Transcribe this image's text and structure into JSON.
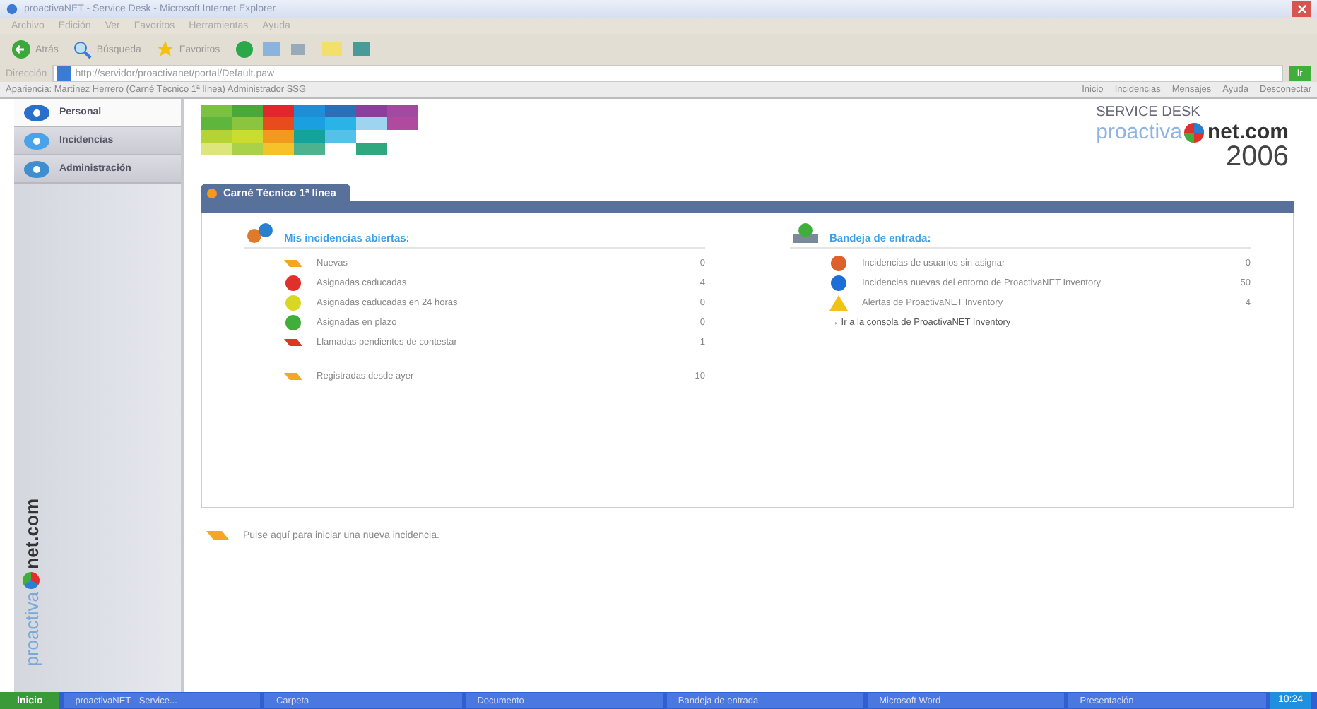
{
  "window": {
    "title": "proactivaNET - Service Desk - Microsoft Internet Explorer"
  },
  "menu": [
    "Archivo",
    "Edición",
    "Ver",
    "Favoritos",
    "Herramientas",
    "Ayuda"
  ],
  "toolbar": [
    {
      "label": "Atrás",
      "kind": "back"
    },
    {
      "label": "Búsqueda",
      "kind": "search"
    },
    {
      "label": "Favoritos",
      "kind": "star"
    }
  ],
  "address": {
    "label": "Dirección",
    "value": "http://servidor/proactivanet/portal/Default.paw",
    "go": "Ir"
  },
  "links_bar": {
    "context": "Apariencia: Martínez Herrero (Carné Técnico 1ª línea) Administrador SSG",
    "links": [
      "Inicio",
      "Incidencias",
      "Mensajes",
      "Ayuda",
      "Desconectar"
    ]
  },
  "sidebar": {
    "items": [
      {
        "label": "Personal",
        "selected": true
      },
      {
        "label": "Incidencias",
        "selected": false
      },
      {
        "label": "Administración",
        "selected": false
      }
    ],
    "brand": {
      "prefix": "proactiva",
      "suffix": "net.com"
    }
  },
  "header": {
    "product": "SERVICE DESK",
    "brand_prefix": "proactiva",
    "brand_suffix": "net.com",
    "year": "2006"
  },
  "panel": {
    "tab": "Carné Técnico 1ª línea",
    "left": {
      "heading": "Mis incidencias abiertas:",
      "items": [
        {
          "label": "Nuevas",
          "count": "0",
          "kind": "new"
        },
        {
          "label": "Asignadas caducadas",
          "count": "4",
          "kind": "late"
        },
        {
          "label": "Asignadas caducadas en 24 horas",
          "count": "0",
          "kind": "soon"
        },
        {
          "label": "Asignadas en plazo",
          "count": "0",
          "kind": "ok"
        },
        {
          "label": "Llamadas pendientes de contestar",
          "count": "1",
          "kind": "call"
        },
        {
          "label": "Registradas desde ayer",
          "count": "10",
          "kind": "new",
          "gap": true
        }
      ]
    },
    "right": {
      "heading": "Bandeja de entrada:",
      "items": [
        {
          "label": "Incidencias de usuarios sin asignar",
          "count": "0",
          "kind": "user"
        },
        {
          "label": "Incidencias nuevas del entorno de ProactivaNET Inventory",
          "count": "50",
          "kind": "info"
        },
        {
          "label": "Alertas de ProactivaNET Inventory",
          "count": "4",
          "kind": "warn"
        },
        {
          "label": "→ Ir a la consola de ProactivaNET Inventory",
          "kind": "link"
        }
      ]
    }
  },
  "footer_note": "Pulse aquí para iniciar una nueva incidencia.",
  "taskbar": {
    "start": "Inicio",
    "tasks": [
      "proactivaNET - Service...",
      "Carpeta",
      "Documento",
      "Bandeja de entrada",
      "Microsoft Word",
      "Presentación"
    ],
    "clock": "10:24"
  }
}
